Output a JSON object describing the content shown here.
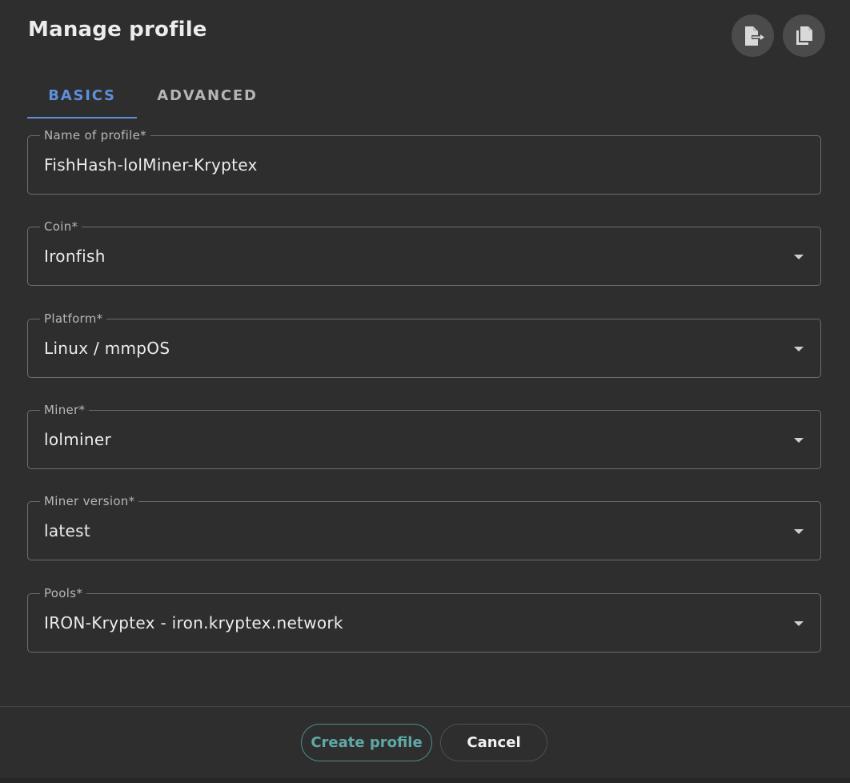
{
  "dialog": {
    "title": "Manage profile",
    "actions": {
      "export_icon": "file-export-icon",
      "copy_icon": "copy-icon"
    }
  },
  "tabs": [
    {
      "label": "BASICS",
      "active": true
    },
    {
      "label": "ADVANCED",
      "active": false
    }
  ],
  "fields": {
    "name": {
      "label": "Name of profile*",
      "value": "FishHash-lolMiner-Kryptex"
    },
    "coin": {
      "label": "Coin*",
      "value": "Ironfish"
    },
    "platform": {
      "label": "Platform*",
      "value": "Linux / mmpOS"
    },
    "miner": {
      "label": "Miner*",
      "value": "lolminer"
    },
    "miner_version": {
      "label": "Miner version*",
      "value": "latest"
    },
    "pools": {
      "label": "Pools*",
      "value": "IRON-Kryptex - iron.kryptex.network"
    }
  },
  "footer": {
    "create_label": "Create profile",
    "cancel_label": "Cancel"
  },
  "colors": {
    "background": "#2e2e2e",
    "accent_tab": "#5f8fd9",
    "accent_create": "#5fa9a6",
    "field_border": "#6e6e6e",
    "icon_button_bg": "#4b4b4b"
  }
}
